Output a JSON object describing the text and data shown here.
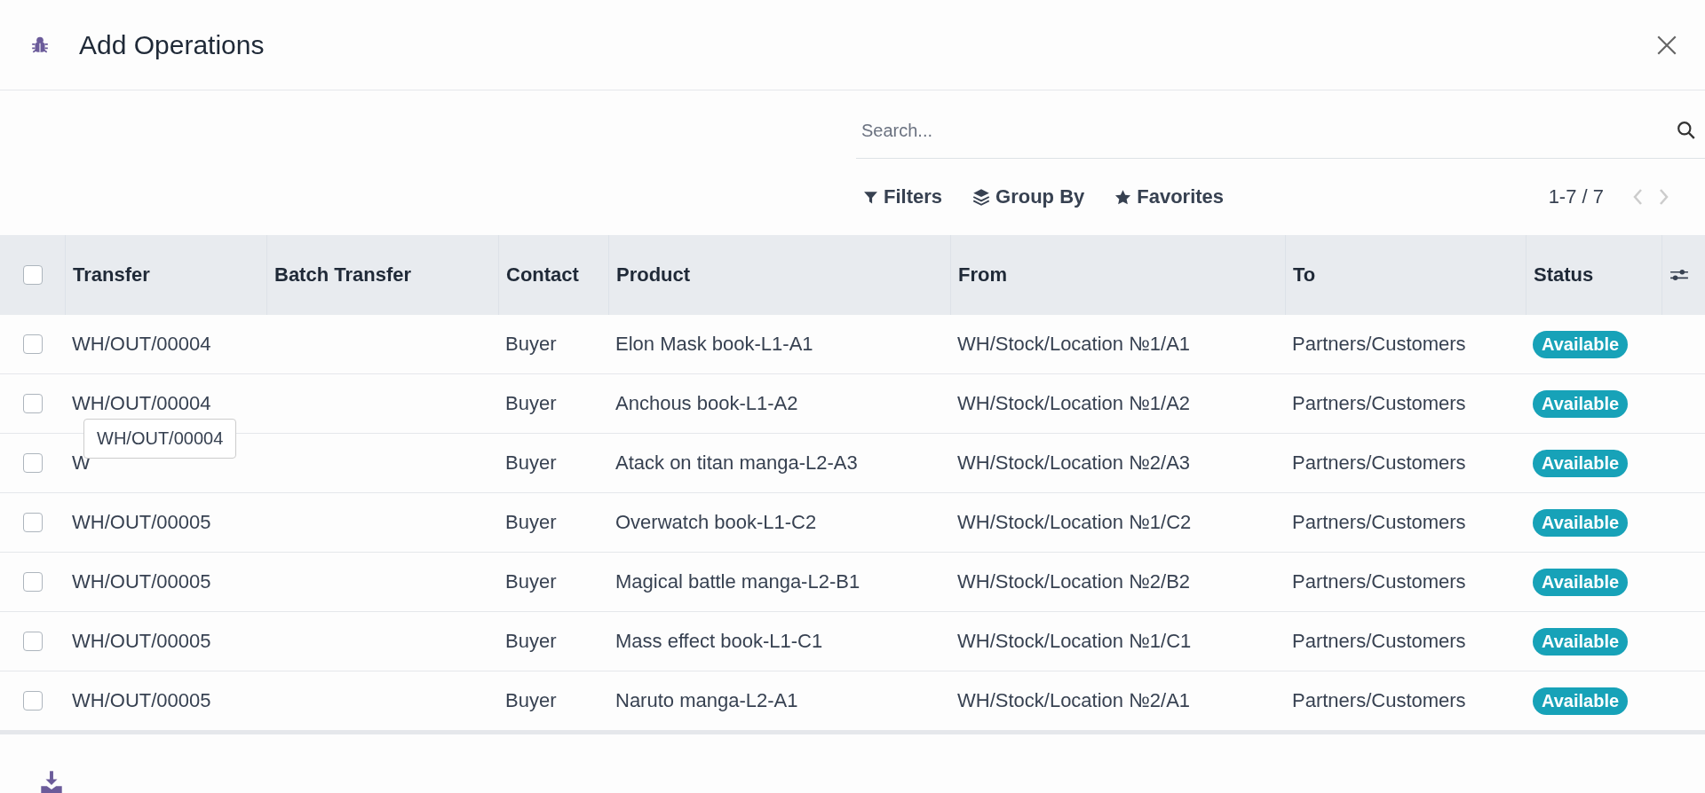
{
  "dialog": {
    "title": "Add Operations"
  },
  "search": {
    "placeholder": "Search..."
  },
  "toolbar": {
    "buttons": [
      {
        "label": "Filters",
        "kind": "filter"
      },
      {
        "label": "Group By",
        "kind": "layers"
      },
      {
        "label": "Favorites",
        "kind": "star"
      }
    ],
    "pager": "1-7 / 7"
  },
  "table": {
    "select_all": {
      "checked": false
    },
    "columns": [
      "Transfer",
      "Batch Transfer",
      "Contact",
      "Product",
      "From",
      "To",
      "Status"
    ],
    "rows": [
      {
        "checked": false,
        "transfer": "WH/OUT/00004",
        "contact": "Buyer",
        "product": "Elon Mask book-L1-A1",
        "from": "WH/Stock/Location №1/A1",
        "to": "Partners/Customers",
        "status": "Available"
      },
      {
        "checked": false,
        "transfer": "WH/OUT/00004",
        "tooltip": "WH/OUT/00004",
        "contact": "Buyer",
        "product": "Anchous book-L1-A2",
        "from": "WH/Stock/Location №1/A2",
        "to": "Partners/Customers",
        "status": "Available"
      },
      {
        "checked": false,
        "transfer": "W",
        "contact": "Buyer",
        "product": "Atack on titan manga-L2-A3",
        "from": "WH/Stock/Location №2/A3",
        "to": "Partners/Customers",
        "status": "Available"
      },
      {
        "checked": false,
        "transfer": "WH/OUT/00005",
        "contact": "Buyer",
        "product": "Overwatch book-L1-C2",
        "from": "WH/Stock/Location №1/C2",
        "to": "Partners/Customers",
        "status": "Available"
      },
      {
        "checked": false,
        "transfer": "WH/OUT/00005",
        "contact": "Buyer",
        "product": "Magical battle manga-L2-B1",
        "from": "WH/Stock/Location №2/B2",
        "to": "Partners/Customers",
        "status": "Available"
      },
      {
        "checked": false,
        "transfer": "WH/OUT/00005",
        "contact": "Buyer",
        "product": "Mass effect book-L1-C1",
        "from": "WH/Stock/Location №1/C1",
        "to": "Partners/Customers",
        "status": "Available"
      },
      {
        "checked": false,
        "transfer": "WH/OUT/00005",
        "contact": "Buyer",
        "product": "Naruto manga-L2-A1",
        "from": "WH/Stock/Location №2/A1",
        "to": "Partners/Customers",
        "status": "Available"
      }
    ]
  }
}
